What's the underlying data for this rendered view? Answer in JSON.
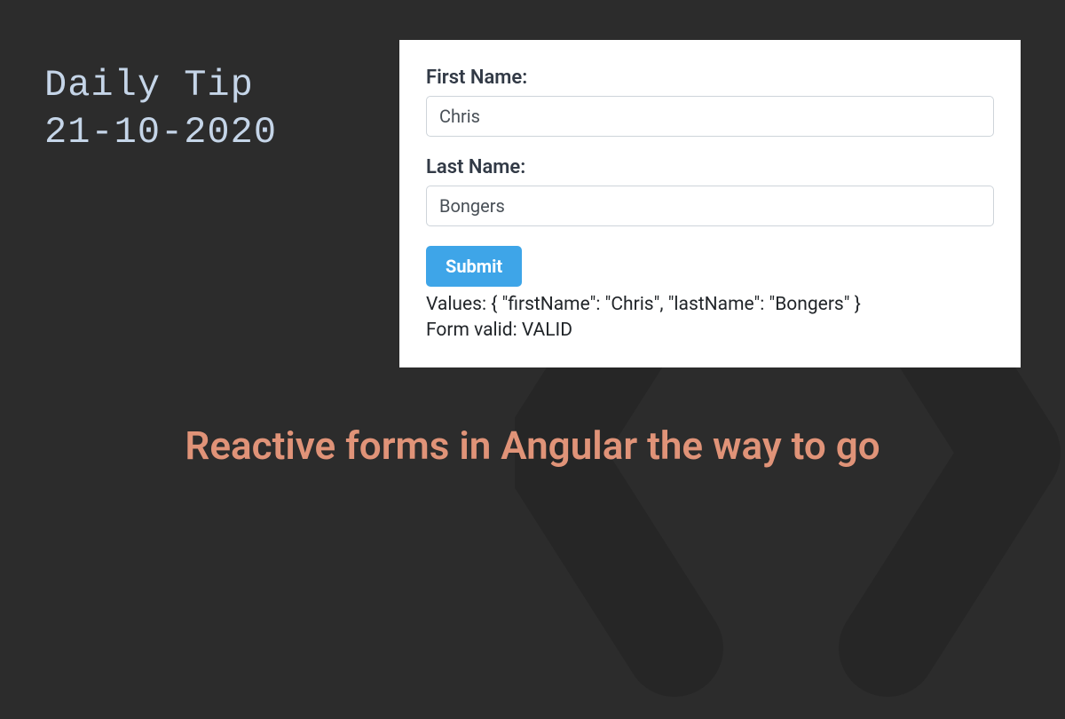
{
  "header": {
    "line1": "Daily Tip",
    "line2": "21-10-2020"
  },
  "form": {
    "firstNameLabel": "First Name:",
    "firstNameValue": "Chris",
    "lastNameLabel": "Last Name:",
    "lastNameValue": "Bongers",
    "submitLabel": "Submit",
    "outputValues": "Values: { \"firstName\": \"Chris\", \"lastName\": \"Bongers\" }",
    "outputValid": "Form valid: VALID"
  },
  "title": "Reactive forms in Angular the way to go"
}
